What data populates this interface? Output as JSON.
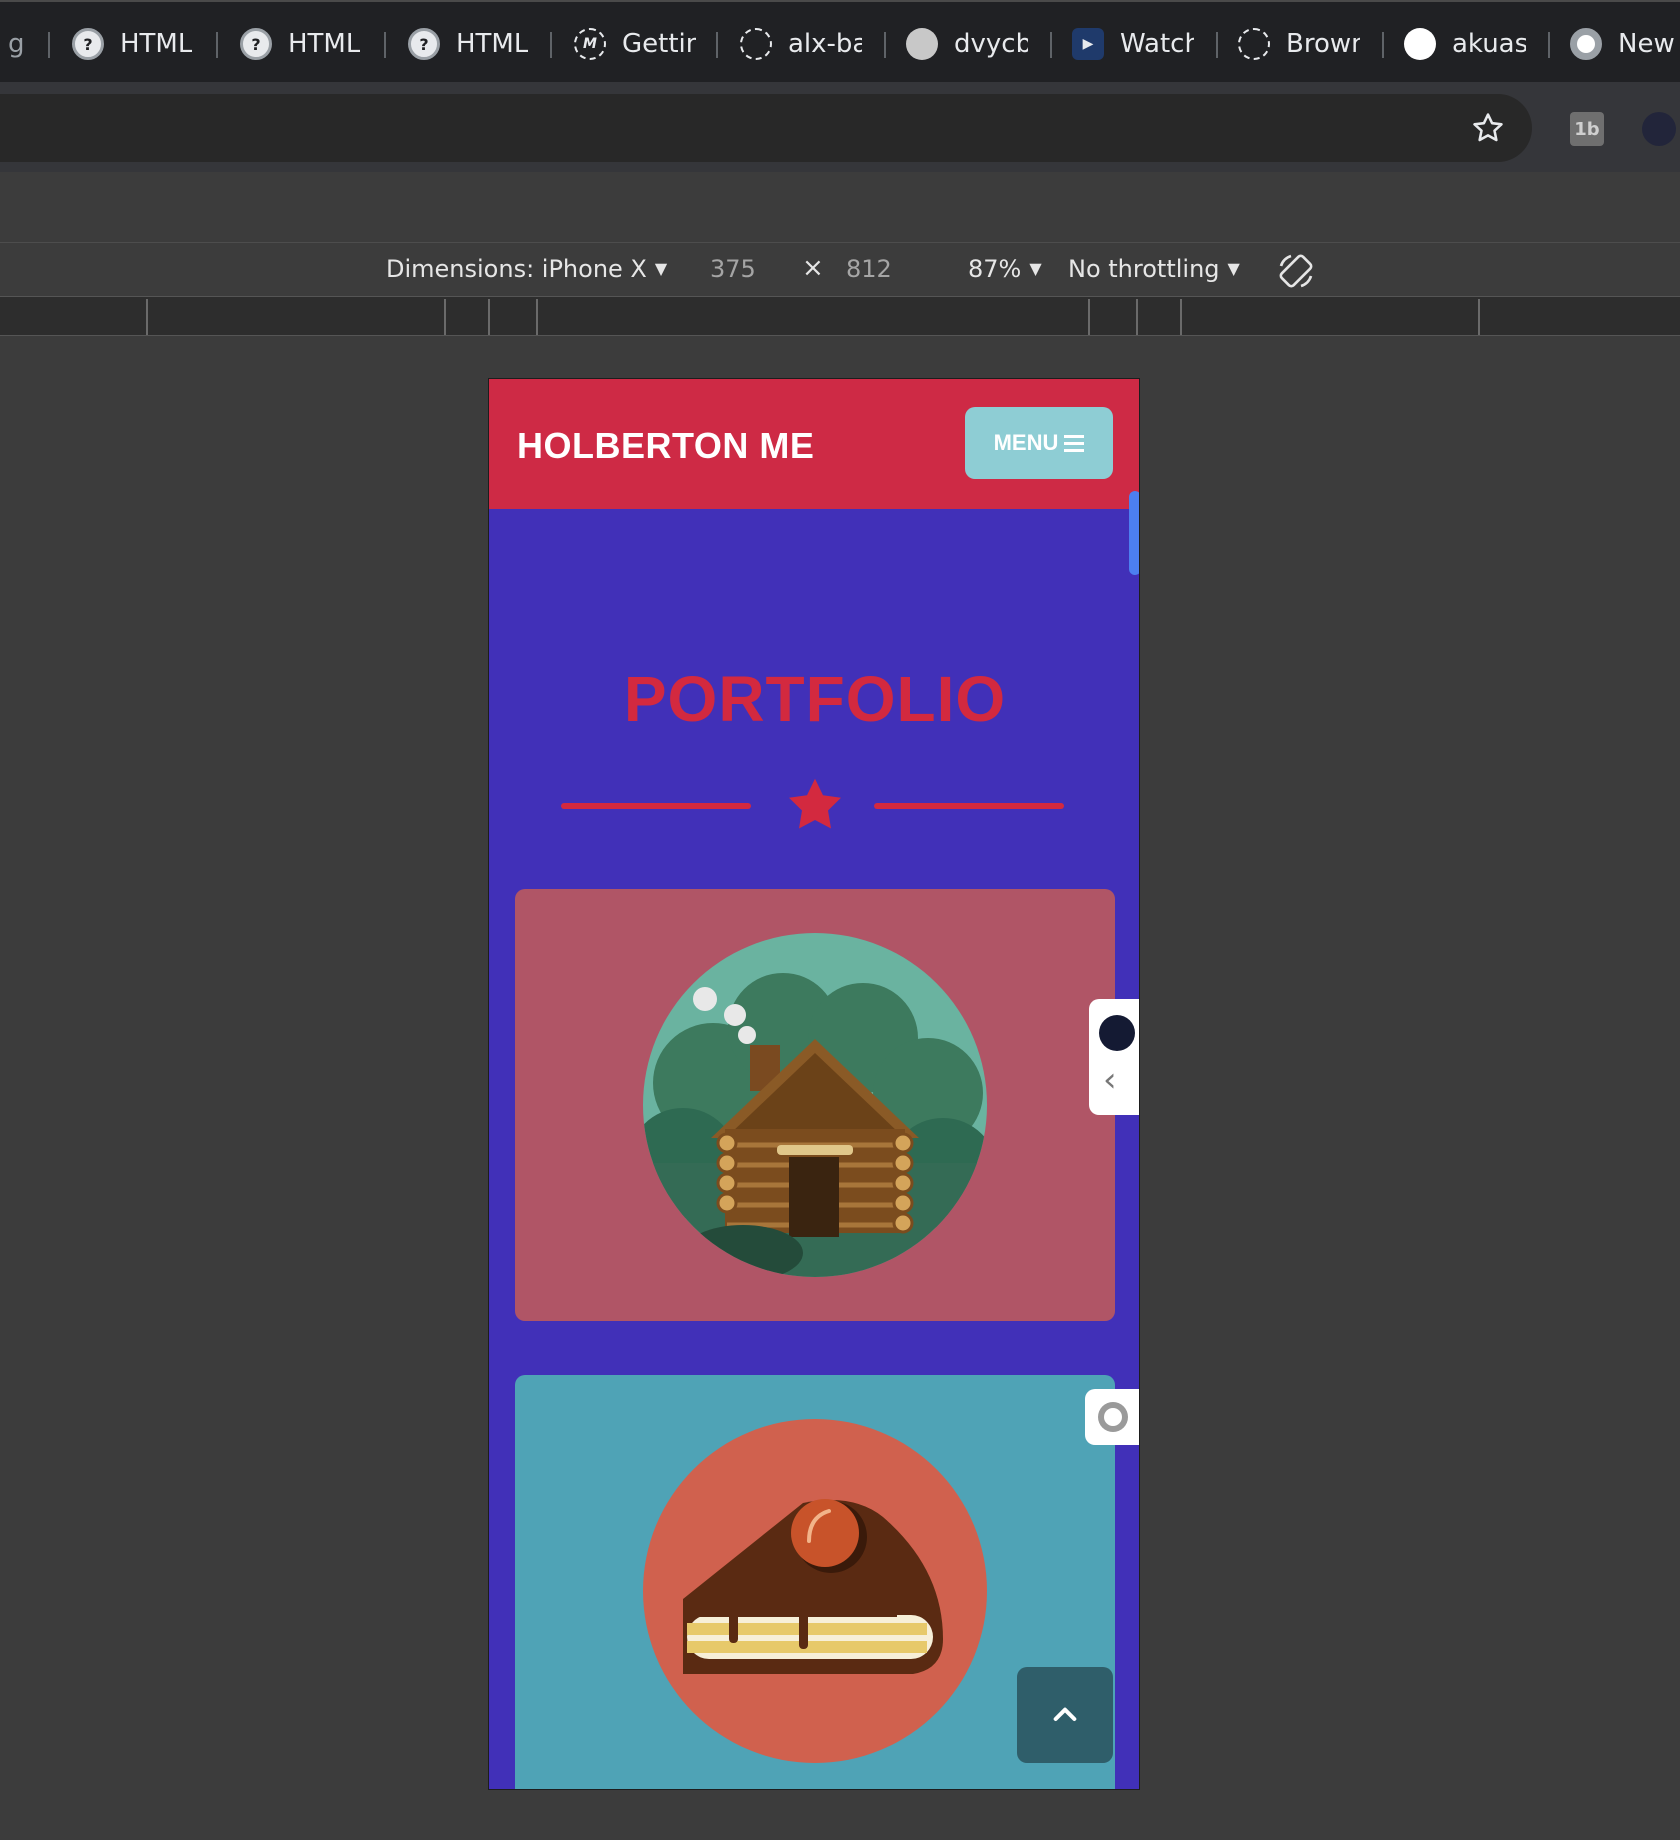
{
  "browser": {
    "tabs": [
      {
        "label": "g",
        "icon": "tab-fragment"
      },
      {
        "label": "HTML",
        "icon": "question-circle-icon"
      },
      {
        "label": "HTML",
        "icon": "question-circle-icon"
      },
      {
        "label": "HTML",
        "icon": "question-circle-icon"
      },
      {
        "label": "Gettin",
        "icon": "m-circle-icon"
      },
      {
        "label": "alx-ba",
        "icon": "github-outline-icon"
      },
      {
        "label": "dvycb",
        "icon": "globe-icon"
      },
      {
        "label": "Watch",
        "icon": "tv-icon"
      },
      {
        "label": "Brown",
        "icon": "loading-ring-icon"
      },
      {
        "label": "akuas",
        "icon": "github-icon"
      },
      {
        "label": "New",
        "icon": "chrome-icon"
      }
    ],
    "extensions": [
      "1b"
    ]
  },
  "devtools": {
    "device_label": "Dimensions: iPhone X",
    "width": "375",
    "times": "×",
    "height": "812",
    "zoom": "87%",
    "throttling": "No throttling"
  },
  "site": {
    "title": "HOLBERTON ME",
    "menu_label": "MENU",
    "section_title": "PORTFOLIO",
    "colors": {
      "header": "#ce2a45",
      "page_bg": "#4130b8",
      "menu_button": "#8ecdd4",
      "title_red": "#d3293f",
      "card_1": "#b05566",
      "card_2": "#4fa3b6",
      "to_top_button": "#2f5e6a"
    },
    "cards": [
      {
        "image": "log-cabin-illustration"
      },
      {
        "image": "cake-slice-illustration"
      }
    ]
  }
}
